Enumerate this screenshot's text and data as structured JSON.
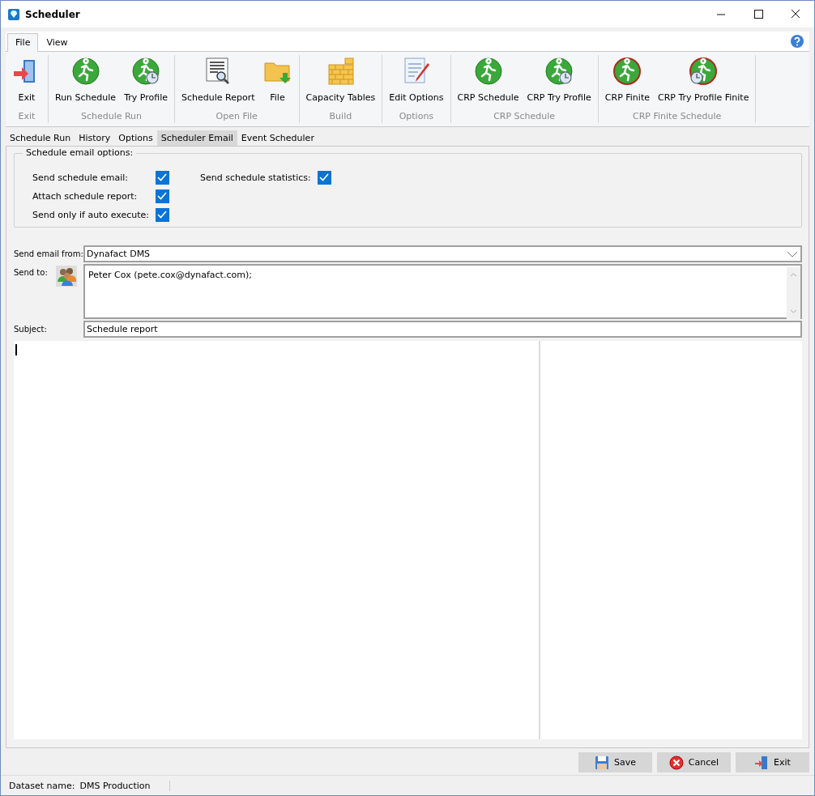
{
  "window": {
    "title": "Scheduler"
  },
  "ribbon_tabs": [
    {
      "label": "File",
      "selected": true
    },
    {
      "label": "View",
      "selected": false
    }
  ],
  "ribbon_groups": [
    {
      "label": "Exit",
      "buttons": [
        {
          "label": "Exit",
          "kind": "exit"
        }
      ]
    },
    {
      "label": "Schedule Run",
      "buttons": [
        {
          "label": "Run Schedule",
          "kind": "run"
        },
        {
          "label": "Try Profile",
          "kind": "run-clock"
        }
      ]
    },
    {
      "label": "Open File",
      "buttons": [
        {
          "label": "Schedule Report",
          "kind": "report"
        },
        {
          "label": "File",
          "kind": "folder"
        }
      ]
    },
    {
      "label": "Build",
      "buttons": [
        {
          "label": "Capacity Tables",
          "kind": "bricks"
        }
      ]
    },
    {
      "label": "Options",
      "buttons": [
        {
          "label": "Edit Options",
          "kind": "edit"
        }
      ]
    },
    {
      "label": "CRP Schedule",
      "buttons": [
        {
          "label": "CRP Schedule",
          "kind": "run"
        },
        {
          "label": "CRP Try Profile",
          "kind": "run-clock"
        }
      ]
    },
    {
      "label": "CRP Finite Schedule",
      "buttons": [
        {
          "label": "CRP Finite",
          "kind": "run-finite"
        },
        {
          "label": "CRP Try Profile Finite",
          "kind": "run-finite-clock"
        }
      ]
    }
  ],
  "tabs": [
    {
      "label": "Schedule Run",
      "selected": false
    },
    {
      "label": "History",
      "selected": false
    },
    {
      "label": "Options",
      "selected": false
    },
    {
      "label": "Scheduler Email",
      "selected": true
    },
    {
      "label": "Event Scheduler",
      "selected": false
    }
  ],
  "email_options": {
    "title": "Schedule email options:",
    "columns": [
      [
        {
          "label": "Send schedule email:",
          "checked": true
        },
        {
          "label": "Attach schedule report:",
          "checked": true
        },
        {
          "label": "Send only if auto execute:",
          "checked": true
        }
      ],
      [
        {
          "label": "Send schedule statistics:",
          "checked": true
        }
      ]
    ]
  },
  "send_from": {
    "label": "Send email from:",
    "value": "Dynafact DMS"
  },
  "send_to": {
    "label": "Send to:",
    "value": "Peter Cox (pete.cox@dynafact.com);"
  },
  "subject": {
    "label": "Subject:",
    "value": "Schedule report"
  },
  "buttons": [
    {
      "label": "Save",
      "kind": "save"
    },
    {
      "label": "Cancel",
      "kind": "cancel"
    },
    {
      "label": "Exit",
      "kind": "exit"
    }
  ],
  "status_bar": {
    "label": "Dataset name:",
    "value": "DMS Production"
  }
}
